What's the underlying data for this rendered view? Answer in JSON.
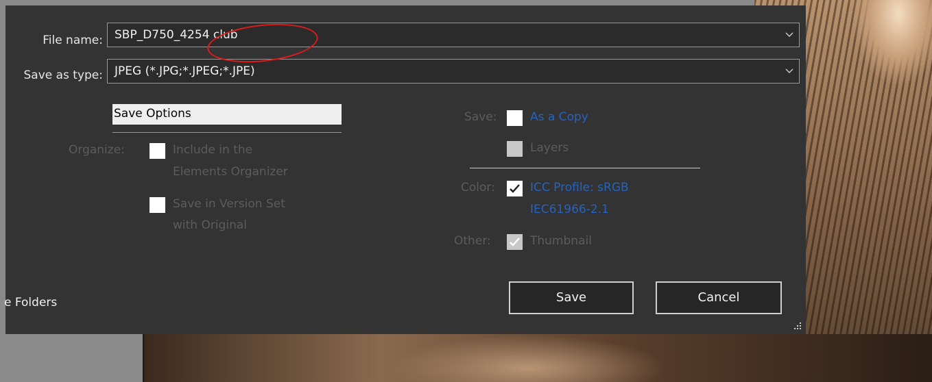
{
  "file_name": {
    "label": "File name:",
    "value": "SBP_D750_4254 club"
  },
  "save_as_type": {
    "label": "Save as type:",
    "value": "JPEG (*.JPG;*.JPEG;*.JPE)"
  },
  "save_options": {
    "title": "Save Options",
    "organize_label": "Organize:",
    "include_organizer_line1": "Include in the",
    "include_organizer_line2": "Elements Organizer",
    "version_set_line1": "Save in Version Set",
    "version_set_line2": "with Original"
  },
  "save_section": {
    "save_label": "Save:",
    "as_a_copy": "As a Copy",
    "layers": "Layers",
    "color_label": "Color:",
    "icc_line1": "ICC Profile:  sRGB",
    "icc_line2": "IEC61966-2.1",
    "other_label": "Other:",
    "thumbnail": "Thumbnail"
  },
  "folders_toggle": "e Folders",
  "buttons": {
    "save": "Save",
    "cancel": "Cancel"
  },
  "colors": {
    "dialog_bg": "#333333",
    "accent_blue": "#2463c2",
    "annotation_red": "#e01b1b"
  },
  "checkbox_states": {
    "include_in_organizer": false,
    "save_in_version_set": false,
    "as_a_copy": false,
    "layers": false,
    "icc_profile": true,
    "thumbnail": true
  }
}
